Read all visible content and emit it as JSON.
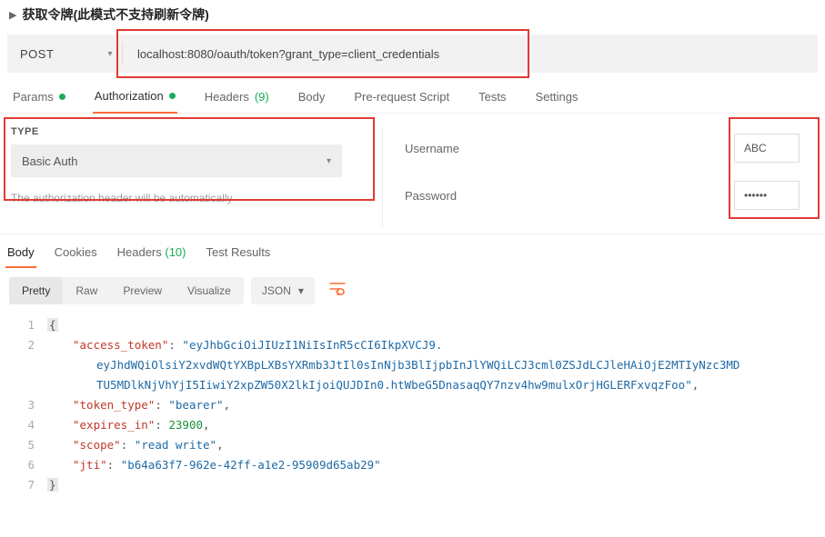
{
  "header": {
    "expand_icon": "▶",
    "title": "获取令牌(此模式不支持刷新令牌)"
  },
  "request": {
    "method": "POST",
    "url": "localhost:8080/oauth/token?grant_type=client_credentials"
  },
  "req_tabs": {
    "params": "Params",
    "authorization": "Authorization",
    "headers": "Headers",
    "headers_count": "(9)",
    "body": "Body",
    "prerequest": "Pre-request Script",
    "tests": "Tests",
    "settings": "Settings"
  },
  "auth": {
    "type_label": "TYPE",
    "type_value": "Basic Auth",
    "desc": "The authorization header will be automatically",
    "username_label": "Username",
    "username_value": "ABC",
    "password_label": "Password",
    "password_value": "••••••"
  },
  "resp_tabs": {
    "body": "Body",
    "cookies": "Cookies",
    "headers": "Headers",
    "headers_count": "(10)",
    "test_results": "Test Results"
  },
  "view_bar": {
    "pretty": "Pretty",
    "raw": "Raw",
    "preview": "Preview",
    "visualize": "Visualize",
    "format": "JSON"
  },
  "response": {
    "access_token_key": "\"access_token\"",
    "access_token_val_1": "\"eyJhbGciOiJIUzI1NiIsInR5cCI6IkpXVCJ9.",
    "access_token_val_2": "eyJhdWQiOlsiY2xvdWQtYXBpLXBsYXRmb3JtIl0sInNjb3BlIjpbInJlYWQiLCJ3cml0ZSJdLCJleHAiOjE2MTIyNzc3MD",
    "access_token_val_3": "TU5MDlkNjVhYjI5IiwiY2xpZW50X2lkIjoiQUJDIn0.htWbeG5DnasaqQY7nzv4hw9mulxOrjHGLERFxvqzFoo\"",
    "token_type_key": "\"token_type\"",
    "token_type_val": "\"bearer\"",
    "expires_in_key": "\"expires_in\"",
    "expires_in_val": "23900",
    "scope_key": "\"scope\"",
    "scope_val": "\"read write\"",
    "jti_key": "\"jti\"",
    "jti_val": "\"b64a63f7-962e-42ff-a1e2-95909d65ab29\""
  },
  "lines": [
    "1",
    "2",
    "3",
    "4",
    "5",
    "6",
    "7"
  ],
  "glyph": {
    "caret": "▾"
  }
}
